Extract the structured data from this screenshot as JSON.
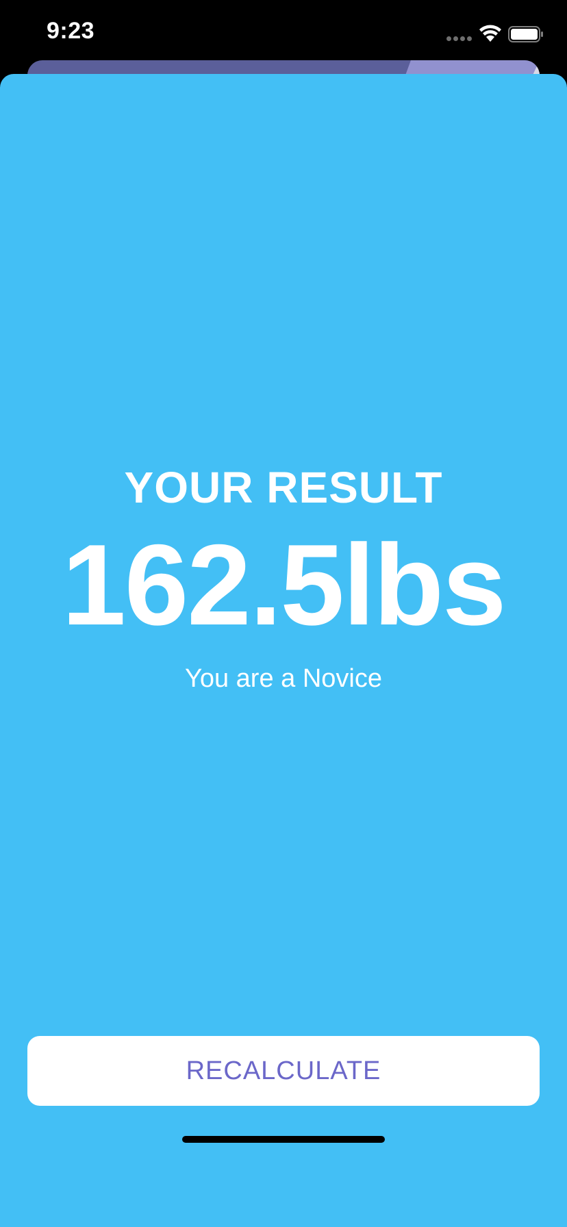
{
  "status_bar": {
    "time": "9:23",
    "icons": [
      "signal-dots-icon",
      "wifi-icon",
      "battery-icon"
    ]
  },
  "result": {
    "title": "YOUR RESULT",
    "value": "162.5lbs",
    "level": "You are a Novice"
  },
  "actions": {
    "recalculate_label": "RECALCULATE"
  },
  "colors": {
    "sheet_background": "#43bff5",
    "button_text": "#6b67c9",
    "button_background": "#ffffff",
    "back_card": "#5b5f9a",
    "back_card_accent": "#9191cf"
  }
}
